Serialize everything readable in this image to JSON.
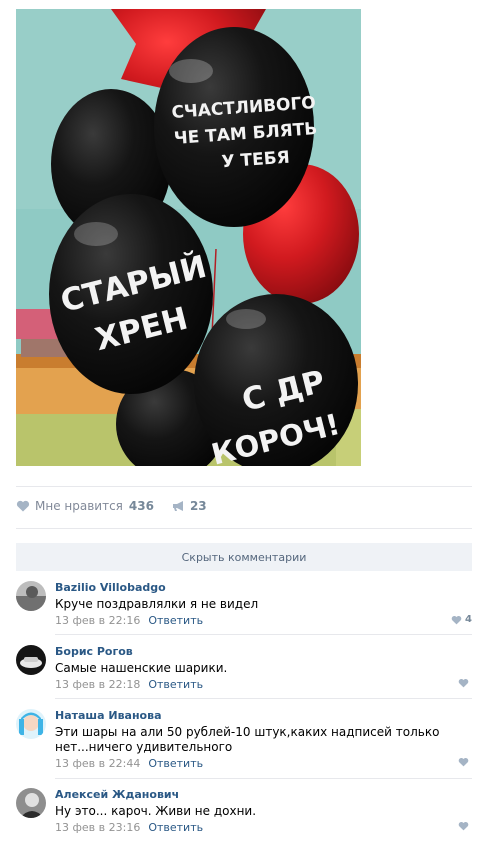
{
  "post": {
    "photo": {
      "balloon_texts": {
        "top_line1": "СЧАСТЛИВОГО",
        "top_line2": "ЧЕ ТАМ БЛЯТЬ",
        "top_line3": "У ТЕБЯ",
        "left_line1": "СТАРЫЙ",
        "left_line2": "ХРЕН",
        "bottom_line1": "С ДР",
        "bottom_line2": "КОРОЧ!"
      }
    },
    "actions": {
      "like_label": "Мне нравится",
      "like_count": "436",
      "share_count": "23"
    },
    "hide_comments_label": "Скрыть комментарии"
  },
  "comments": [
    {
      "author": "Bazilio Villobadgo",
      "text": "Круче поздравлялки я не видел",
      "date": "13 фев в 22:16",
      "reply": "Ответить",
      "likes": "4"
    },
    {
      "author": "Борис Рогов",
      "text": "Самые нашенские шарики.",
      "date": "13 фев в 22:18",
      "reply": "Ответить",
      "likes": ""
    },
    {
      "author": "Наташа Иванова",
      "text": "Эти шары на али 50 рублей-10 штук,каких надписей только нет...ничего удивительного",
      "date": "13 фев в 22:44",
      "reply": "Ответить",
      "likes": ""
    },
    {
      "author": "Алексей Жданович",
      "text": "Ну это... кароч. Живи не дохни.",
      "date": "13 фев в 23:16",
      "reply": "Ответить",
      "likes": ""
    }
  ],
  "colors": {
    "link": "#2a5885",
    "muted": "#939393",
    "action_icon": "#a5b4c5",
    "balloon_black": "#111111",
    "balloon_red": "#c41a1f"
  },
  "icons": {
    "like": "heart-icon",
    "share": "megaphone-icon"
  }
}
